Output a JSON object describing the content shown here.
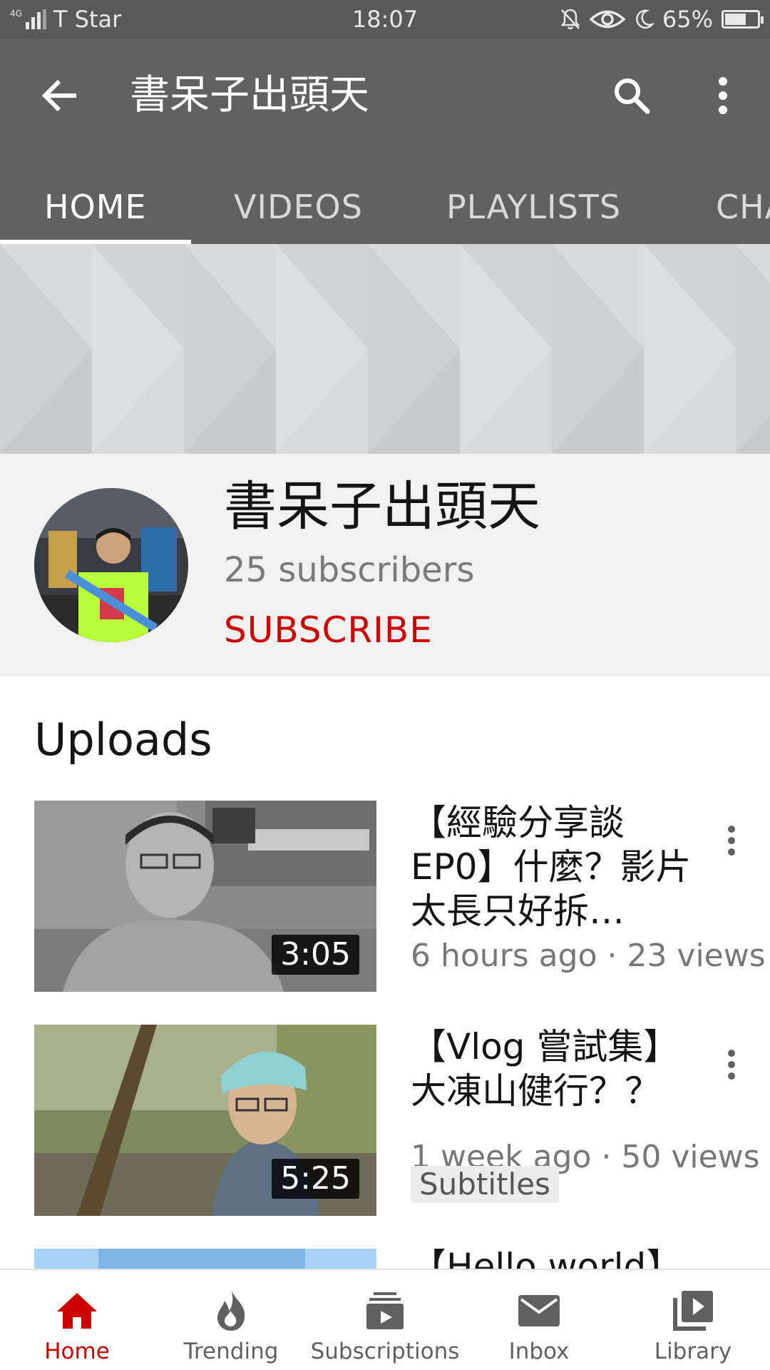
{
  "status_bar": {
    "network": "4G",
    "carrier": "T Star",
    "time": "18:07",
    "battery": "65%",
    "battery_level": 0.65,
    "icons": [
      "mute-bell-icon",
      "eye-icon",
      "moon-icon"
    ]
  },
  "app_bar": {
    "title": "書呆子出頭天",
    "icons": [
      "back-arrow-icon",
      "search-icon",
      "more-vert-icon"
    ]
  },
  "tabs": [
    {
      "label": "HOME",
      "active": true
    },
    {
      "label": "VIDEOS",
      "active": false
    },
    {
      "label": "PLAYLISTS",
      "active": false
    },
    {
      "label": "CHA",
      "active": false
    }
  ],
  "channel": {
    "name": "書呆子出頭天",
    "subscribers": "25 subscribers",
    "subscribe_label": "SUBSCRIBE"
  },
  "uploads": {
    "title": "Uploads",
    "videos": [
      {
        "title": "【經驗分享談EP0】什麼？影片太長只好拆…",
        "meta": "6 hours ago · 23 views",
        "duration": "3:05"
      },
      {
        "title": "【Vlog 嘗試集】大凍山健行？？",
        "meta": "1 week ago · 50 views",
        "duration": "5:25",
        "badge": "Subtitles"
      },
      {
        "title": "【Hello world】",
        "meta": "",
        "duration": ""
      }
    ]
  },
  "bottom_nav": [
    {
      "label": "Home",
      "icon": "home-icon",
      "active": true
    },
    {
      "label": "Trending",
      "icon": "flame-icon",
      "active": false
    },
    {
      "label": "Subscriptions",
      "icon": "subscriptions-icon",
      "active": false
    },
    {
      "label": "Inbox",
      "icon": "mail-icon",
      "active": false
    },
    {
      "label": "Library",
      "icon": "library-icon",
      "active": false
    }
  ],
  "colors": {
    "status_bar": "#595959",
    "app_bar": "#616161",
    "accent_red": "#cc0000",
    "channel_bg": "#f1f1f1"
  }
}
